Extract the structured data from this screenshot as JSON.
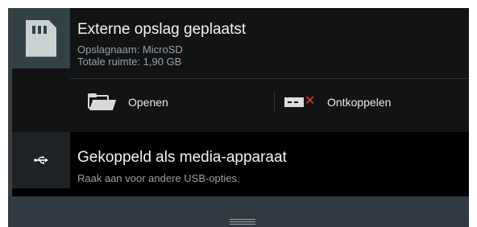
{
  "storage_notification": {
    "icon": "sd-card-icon",
    "title": "Externe opslag geplaatst",
    "storage_name": "Opslagnaam: MicroSD",
    "total_space": "Totale ruimte: 1,90 GB",
    "actions": {
      "open_label": "Openen",
      "open_icon": "folder-icon",
      "unmount_label": "Ontkoppelen",
      "unmount_icon": "unmount-icon"
    }
  },
  "usb_notification": {
    "icon": "usb-icon",
    "title": "Gekoppeld als media-apparaat",
    "subtitle": "Raak aan voor andere USB-opties."
  },
  "colors": {
    "panel_bg": "#121314",
    "icon_bg": "#314247",
    "bottom_bar": "#313a42",
    "eject_x": "#e53935"
  }
}
